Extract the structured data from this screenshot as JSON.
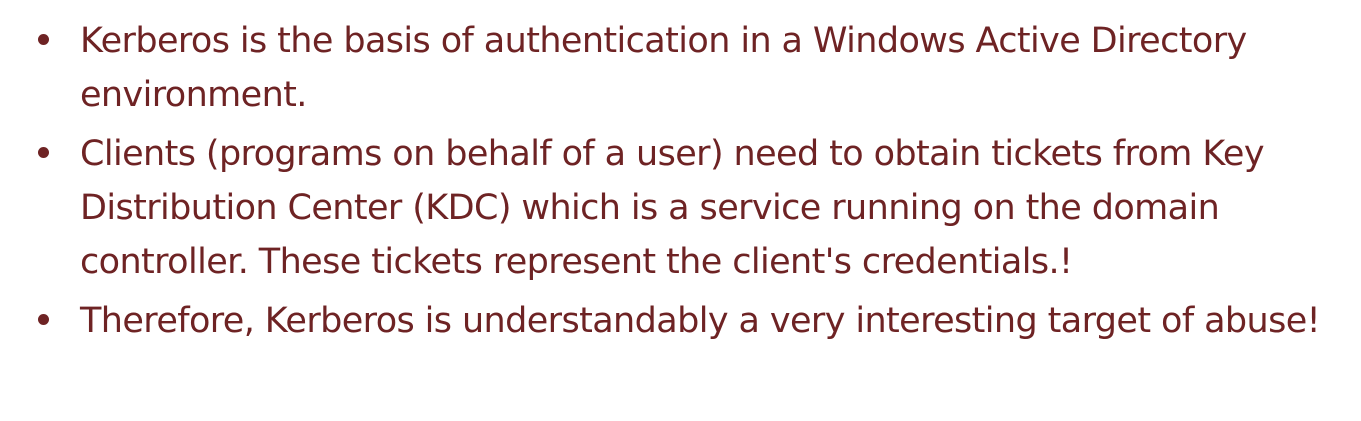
{
  "bullets": [
    {
      "text": "Kerberos is the basis of authentication in a Windows Active Directory environment."
    },
    {
      "text": "Clients (programs on behalf of a user) need to obtain tickets from Key Distribution Center (KDC) which is a service running on the domain controller. These tickets represent the client's credentials.!"
    },
    {
      "text": "Therefore, Kerberos is understandably a very interesting target of abuse!"
    }
  ],
  "colors": {
    "text": "#6e2324",
    "background": "#ffffff"
  }
}
